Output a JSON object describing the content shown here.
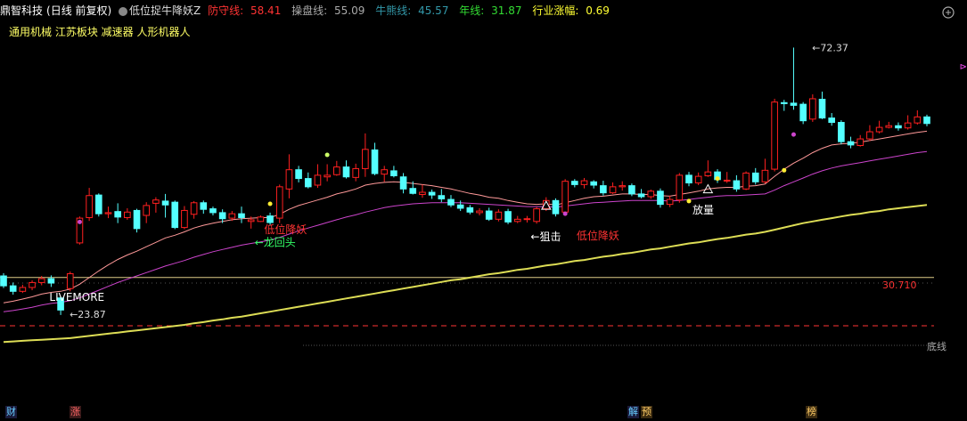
{
  "header": {
    "stock": "鼎智科技",
    "period": "(日线 前复权)",
    "indicator": "低位捉牛降妖Z",
    "fields": [
      {
        "label": "防守线:",
        "value": "58.41",
        "color": "#ff3333"
      },
      {
        "label": "操盘线:",
        "value": "55.09",
        "color": "#aaaaaa"
      },
      {
        "label": "牛熊线:",
        "value": "45.57",
        "color": "#3399aa"
      },
      {
        "label": "年线:",
        "value": "31.87",
        "color": "#33dd33"
      },
      {
        "label": "行业涨幅:",
        "value": "0.69",
        "color": "#ffff33"
      }
    ]
  },
  "sector_tags": "通用机械 江苏板块 减速器 人形机器人",
  "bottom_tags": [
    {
      "text": "财",
      "color": "#66ccff",
      "bg": "#1a1a3a"
    },
    {
      "text": "涨",
      "color": "#ff6666",
      "bg": "#3a1a1a"
    },
    {
      "text": "解",
      "color": "#66ccff",
      "bg": "#1a1a3a"
    },
    {
      "text": "预",
      "color": "#ffcc66",
      "bg": "#3a2a10"
    },
    {
      "text": "榜",
      "color": "#ffcc66",
      "bg": "#3a2a10"
    }
  ],
  "colors": {
    "up": "#ff2020",
    "down": "#54ffff",
    "defense": "#ff9999",
    "trade": "#cc44cc",
    "bullbear": "#dddd55",
    "yearline": "#eeee88"
  },
  "chart_data": {
    "type": "candlestick",
    "y_scale": [
      20,
      75
    ],
    "high_label": "72.37",
    "low_label": "23.87",
    "hline_value": "30.710",
    "bottom_label": "底线",
    "annotations": [
      {
        "text": "LIVEMORE",
        "color": "#ffffff",
        "at": 4
      },
      {
        "text": "低位降妖",
        "color": "#ff3333",
        "at": 26
      },
      {
        "text": "←龙回头",
        "color": "#33ff66",
        "at": 24
      },
      {
        "text": "←狙击",
        "color": "#ffffff",
        "at": 55
      },
      {
        "text": "低位降妖",
        "color": "#ff3333",
        "at": 60
      },
      {
        "text": "放量",
        "color": "#ffffff",
        "at": 72
      }
    ],
    "candles": [
      [
        31.0,
        29.2,
        31.5,
        28.8
      ],
      [
        29.2,
        28.2,
        29.8,
        27.6
      ],
      [
        28.2,
        28.9,
        29.4,
        27.9
      ],
      [
        28.9,
        29.8,
        30.2,
        28.4
      ],
      [
        29.8,
        30.5,
        31.0,
        29.3
      ],
      [
        30.5,
        29.7,
        31.1,
        29.0
      ],
      [
        27.0,
        24.8,
        27.3,
        23.9
      ],
      [
        28.7,
        31.4,
        31.8,
        28.2
      ],
      [
        37.0,
        41.5,
        41.8,
        36.7
      ],
      [
        41.6,
        45.6,
        47.0,
        41.0
      ],
      [
        45.7,
        42.3,
        46.0,
        41.8
      ],
      [
        42.3,
        42.5,
        43.6,
        41.5
      ],
      [
        42.7,
        41.7,
        44.2,
        40.6
      ],
      [
        41.6,
        42.6,
        43.3,
        41.2
      ],
      [
        42.9,
        39.6,
        43.2,
        38.9
      ],
      [
        42.0,
        43.8,
        44.4,
        40.6
      ],
      [
        44.2,
        44.8,
        45.3,
        42.5
      ],
      [
        44.6,
        43.9,
        45.9,
        41.6
      ],
      [
        44.4,
        39.8,
        44.7,
        39.5
      ],
      [
        39.8,
        42.9,
        43.7,
        39.5
      ],
      [
        42.2,
        44.3,
        44.6,
        41.4
      ],
      [
        44.3,
        43.1,
        44.7,
        42.3
      ],
      [
        43.2,
        42.5,
        43.6,
        42.0
      ],
      [
        42.5,
        41.4,
        43.1,
        40.6
      ],
      [
        41.5,
        42.3,
        42.8,
        41.0
      ],
      [
        42.3,
        41.6,
        43.6,
        40.6
      ],
      [
        40.9,
        41.2,
        41.8,
        39.6
      ],
      [
        40.9,
        41.7,
        42.0,
        40.8
      ],
      [
        41.9,
        40.7,
        42.5,
        40.3
      ],
      [
        41.5,
        47.2,
        47.6,
        40.6
      ],
      [
        46.8,
        50.3,
        53.1,
        45.1
      ],
      [
        50.3,
        48.7,
        51.0,
        48.0
      ],
      [
        48.7,
        47.2,
        49.8,
        46.9
      ],
      [
        47.5,
        49.3,
        51.3,
        47.0
      ],
      [
        49.0,
        49.3,
        51.3,
        48.2
      ],
      [
        49.4,
        50.8,
        51.9,
        49.2
      ],
      [
        50.8,
        49.0,
        52.0,
        48.7
      ],
      [
        48.9,
        50.5,
        51.4,
        48.2
      ],
      [
        50.5,
        54.0,
        56.9,
        49.0
      ],
      [
        53.9,
        49.6,
        55.2,
        49.3
      ],
      [
        49.5,
        50.3,
        51.0,
        48.1
      ],
      [
        50.1,
        49.2,
        51.0,
        48.9
      ],
      [
        49.0,
        46.8,
        49.7,
        46.0
      ],
      [
        46.9,
        46.0,
        48.2,
        45.8
      ],
      [
        45.8,
        46.2,
        47.6,
        45.2
      ],
      [
        46.2,
        45.7,
        46.7,
        45.0
      ],
      [
        45.6,
        45.0,
        46.8,
        44.4
      ],
      [
        44.9,
        43.9,
        45.7,
        43.5
      ],
      [
        43.9,
        43.3,
        44.7,
        42.8
      ],
      [
        43.4,
        42.6,
        43.9,
        42.2
      ],
      [
        42.5,
        42.8,
        43.3,
        42.0
      ],
      [
        42.8,
        41.3,
        43.4,
        41.0
      ],
      [
        41.3,
        42.6,
        43.1,
        40.9
      ],
      [
        42.7,
        40.8,
        43.2,
        40.4
      ],
      [
        40.9,
        41.3,
        41.9,
        40.6
      ],
      [
        41.4,
        41.4,
        41.9,
        40.7
      ],
      [
        40.9,
        43.2,
        43.5,
        40.5
      ],
      [
        43.2,
        44.7,
        45.3,
        42.8
      ],
      [
        44.7,
        42.3,
        45.1,
        41.8
      ],
      [
        42.6,
        48.2,
        48.6,
        42.3
      ],
      [
        48.2,
        47.6,
        48.6,
        47.1
      ],
      [
        47.6,
        48.3,
        48.8,
        46.9
      ],
      [
        48.1,
        47.5,
        48.4,
        46.9
      ],
      [
        47.4,
        46.1,
        48.3,
        45.6
      ],
      [
        46.1,
        47.2,
        48.0,
        45.9
      ],
      [
        47.2,
        47.4,
        48.2,
        46.5
      ],
      [
        47.4,
        45.9,
        47.8,
        45.5
      ],
      [
        45.9,
        45.4,
        46.8,
        45.1
      ],
      [
        45.4,
        46.4,
        46.7,
        45.0
      ],
      [
        46.4,
        44.0,
        46.9,
        43.4
      ],
      [
        44.0,
        44.9,
        45.6,
        43.5
      ],
      [
        44.8,
        49.3,
        49.7,
        44.3
      ],
      [
        49.3,
        47.9,
        49.9,
        47.3
      ],
      [
        47.9,
        49.1,
        49.8,
        47.5
      ],
      [
        49.2,
        49.9,
        52.0,
        49.0
      ],
      [
        49.9,
        48.5,
        50.4,
        47.9
      ],
      [
        48.4,
        48.4,
        49.9,
        47.9
      ],
      [
        48.3,
        46.8,
        49.3,
        46.3
      ],
      [
        46.8,
        49.7,
        50.0,
        46.6
      ],
      [
        49.7,
        48.1,
        50.6,
        47.6
      ],
      [
        48.1,
        50.2,
        52.3,
        47.8
      ],
      [
        50.4,
        62.6,
        63.2,
        50.0
      ],
      [
        62.5,
        62.3,
        63.0,
        61.0
      ],
      [
        62.4,
        62.0,
        72.5,
        61.2
      ],
      [
        62.2,
        59.2,
        62.6,
        58.6
      ],
      [
        59.5,
        63.2,
        64.0,
        59.0
      ],
      [
        63.1,
        59.7,
        64.5,
        59.5
      ],
      [
        59.7,
        58.9,
        60.6,
        58.3
      ],
      [
        58.9,
        55.4,
        59.3,
        54.9
      ],
      [
        55.4,
        54.8,
        56.3,
        54.2
      ],
      [
        54.7,
        55.9,
        56.6,
        54.5
      ],
      [
        55.9,
        57.2,
        58.4,
        55.5
      ],
      [
        57.2,
        58.0,
        59.2,
        56.9
      ],
      [
        58.0,
        58.3,
        59.0,
        57.8
      ],
      [
        58.3,
        57.9,
        58.9,
        57.4
      ],
      [
        57.9,
        58.8,
        60.2,
        57.6
      ],
      [
        58.8,
        59.9,
        61.1,
        58.5
      ],
      [
        59.9,
        58.7,
        60.3,
        58.2
      ]
    ],
    "series": [
      {
        "name": "防守线",
        "values": [
          26.1,
          26.4,
          26.8,
          27.2,
          27.7,
          28.0,
          28.2,
          28.6,
          29.5,
          30.7,
          31.9,
          33.0,
          34.0,
          34.8,
          35.5,
          36.3,
          37.1,
          37.9,
          38.4,
          39.0,
          39.7,
          40.2,
          40.6,
          40.9,
          41.2,
          41.4,
          41.5,
          41.6,
          41.6,
          42.2,
          43.1,
          43.8,
          44.3,
          44.8,
          45.3,
          45.9,
          46.3,
          46.8,
          47.5,
          47.8,
          48.0,
          48.1,
          48.0,
          47.8,
          47.6,
          47.4,
          47.1,
          46.8,
          46.4,
          46.0,
          45.7,
          45.3,
          45.1,
          44.7,
          44.4,
          44.1,
          44.0,
          44.1,
          43.9,
          44.3,
          44.7,
          45.1,
          45.4,
          45.5,
          45.7,
          45.9,
          45.9,
          45.8,
          45.8,
          45.6,
          45.5,
          45.8,
          46.1,
          46.4,
          46.8,
          47.0,
          47.1,
          47.1,
          47.3,
          47.4,
          47.7,
          49.1,
          50.4,
          51.5,
          52.4,
          53.4,
          54.2,
          54.8,
          55.0,
          55.1,
          55.3,
          55.6,
          55.9,
          56.2,
          56.5,
          56.8,
          57.1,
          57.3
        ]
      },
      {
        "name": "操盘线",
        "values": [
          24.5,
          24.7,
          25.0,
          25.3,
          25.7,
          26.0,
          26.2,
          26.5,
          27.0,
          27.7,
          28.4,
          29.1,
          29.8,
          30.4,
          31.0,
          31.6,
          32.2,
          32.8,
          33.3,
          33.8,
          34.4,
          34.9,
          35.4,
          35.8,
          36.2,
          36.6,
          36.9,
          37.2,
          37.5,
          38.0,
          38.6,
          39.2,
          39.7,
          40.2,
          40.7,
          41.2,
          41.7,
          42.1,
          42.6,
          43.0,
          43.4,
          43.7,
          43.9,
          44.1,
          44.2,
          44.3,
          44.3,
          44.3,
          44.3,
          44.2,
          44.1,
          44.0,
          43.9,
          43.8,
          43.7,
          43.6,
          43.6,
          43.6,
          43.5,
          43.7,
          43.9,
          44.1,
          44.3,
          44.4,
          44.5,
          44.6,
          44.7,
          44.7,
          44.7,
          44.7,
          44.6,
          44.7,
          44.9,
          45.1,
          45.3,
          45.5,
          45.6,
          45.6,
          45.7,
          45.8,
          45.9,
          46.6,
          47.4,
          48.1,
          48.8,
          49.5,
          50.1,
          50.6,
          51.0,
          51.3,
          51.6,
          51.9,
          52.2,
          52.5,
          52.8,
          53.1,
          53.4,
          53.6
        ]
      },
      {
        "name": "牛熊线",
        "values": [
          19.0,
          19.1,
          19.2,
          19.3,
          19.4,
          19.5,
          19.6,
          19.7,
          19.9,
          20.1,
          20.3,
          20.5,
          20.7,
          20.9,
          21.1,
          21.3,
          21.5,
          21.7,
          21.9,
          22.1,
          22.4,
          22.6,
          22.9,
          23.1,
          23.4,
          23.6,
          23.9,
          24.2,
          24.5,
          24.8,
          25.1,
          25.4,
          25.7,
          26.0,
          26.3,
          26.6,
          26.9,
          27.2,
          27.5,
          27.8,
          28.1,
          28.4,
          28.7,
          29.0,
          29.3,
          29.6,
          29.9,
          30.2,
          30.4,
          30.7,
          31.0,
          31.3,
          31.5,
          31.8,
          32.1,
          32.3,
          32.6,
          32.9,
          33.1,
          33.4,
          33.7,
          33.9,
          34.2,
          34.5,
          34.7,
          35.0,
          35.2,
          35.5,
          35.8,
          36.0,
          36.3,
          36.6,
          36.9,
          37.1,
          37.4,
          37.7,
          37.9,
          38.2,
          38.5,
          38.7,
          39.0,
          39.4,
          39.8,
          40.2,
          40.6,
          40.9,
          41.2,
          41.5,
          41.8,
          42.1,
          42.3,
          42.6,
          42.8,
          43.1,
          43.3,
          43.5,
          43.7,
          43.9
        ]
      }
    ]
  }
}
